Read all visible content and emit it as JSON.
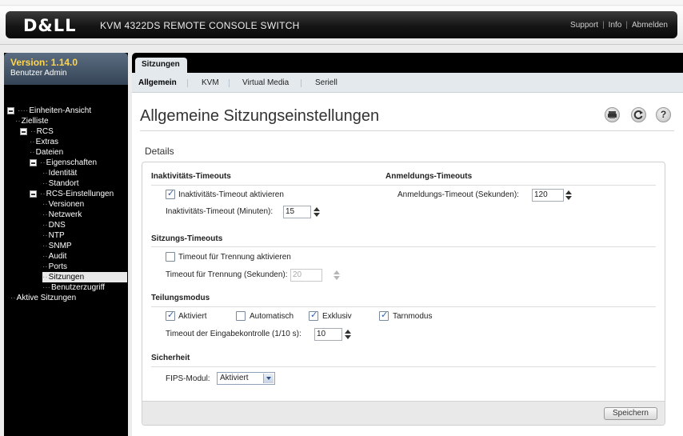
{
  "header": {
    "logo": "D&LL",
    "product_title": "KVM 4322DS REMOTE CONSOLE SWITCH",
    "links": [
      "Support",
      "Info",
      "Abmelden"
    ],
    "separator": "|"
  },
  "sidebar": {
    "version": "Version: 1.14.0",
    "user": "Benutzer Admin",
    "tree": [
      {
        "label": "Einheiten-Ansicht",
        "expander": true
      },
      {
        "label": "Zielliste"
      },
      {
        "label": "RCS",
        "expander": true
      },
      {
        "label": "Extras"
      },
      {
        "label": "Dateien"
      },
      {
        "label": "Eigenschaften",
        "expander": true
      },
      {
        "label": "Identität"
      },
      {
        "label": "Standort"
      },
      {
        "label": "RCS-Einstellungen",
        "expander": true
      },
      {
        "label": "Versionen"
      },
      {
        "label": "Netzwerk"
      },
      {
        "label": "DNS"
      },
      {
        "label": "NTP"
      },
      {
        "label": "SNMP"
      },
      {
        "label": "Audit"
      },
      {
        "label": "Ports"
      },
      {
        "label": "Sitzungen",
        "selected": true
      },
      {
        "label": "Benutzerzugriff"
      },
      {
        "label": "Aktive Sitzungen"
      }
    ]
  },
  "tabs": {
    "main": "Sitzungen",
    "sub": [
      "Allgemein",
      "KVM",
      "Virtual Media",
      "Seriell"
    ],
    "active_sub": "Allgemein"
  },
  "page": {
    "title": "Allgemeine Sitzungseinstellungen",
    "icons": [
      "print-icon",
      "refresh-icon",
      "help-icon"
    ],
    "details_label": "Details"
  },
  "form": {
    "inactivity": {
      "heading": "Inaktivitäts-Timeouts",
      "enable_label": "Inaktivitäts-Timeout aktivieren",
      "enable_checked": true,
      "minutes_label": "Inaktivitäts-Timeout (Minuten):",
      "minutes_value": "15"
    },
    "login": {
      "heading": "Anmeldungs-Timeouts",
      "seconds_label": "Anmeldungs-Timeout (Sekunden):",
      "seconds_value": "120"
    },
    "session": {
      "heading": "Sitzungs-Timeouts",
      "disconnect_label": "Timeout für Trennung aktivieren",
      "disconnect_checked": false,
      "disconnect_seconds_label": "Timeout für Trennung (Sekunden):",
      "disconnect_seconds_value": "20"
    },
    "sharing": {
      "heading": "Teilungsmodus",
      "options": [
        {
          "label": "Aktiviert",
          "checked": true
        },
        {
          "label": "Automatisch",
          "checked": false
        },
        {
          "label": "Exklusiv",
          "checked": true
        },
        {
          "label": "Tarnmodus",
          "checked": true
        }
      ],
      "input_timeout_label": "Timeout der Eingabekontrolle (1/10 s):",
      "input_timeout_value": "10"
    },
    "security": {
      "heading": "Sicherheit",
      "fips_label": "FIPS-Modul:",
      "fips_value": "Aktiviert"
    },
    "save_label": "Speichern"
  }
}
